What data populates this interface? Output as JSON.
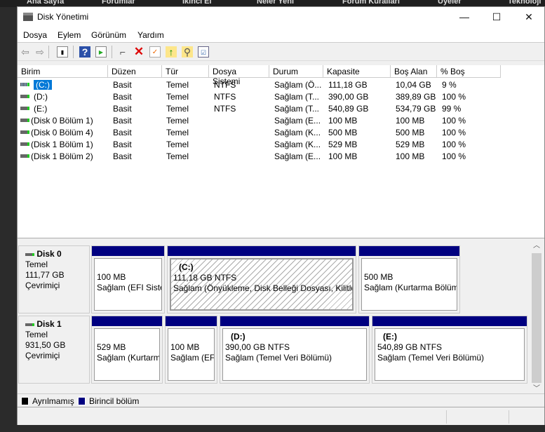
{
  "background_tabs": [
    "Ana Sayfa",
    "Forumlar",
    "İkinci El",
    "Neler Yeni",
    "Forum Kuralları",
    "Üyeler",
    "Teknoloji"
  ],
  "window": {
    "title": "Disk Yönetimi",
    "minimize": "—",
    "maximize": "☐",
    "close": "✕"
  },
  "menu": [
    "Dosya",
    "Eylem",
    "Görünüm",
    "Yardım"
  ],
  "toolbar": [
    "back-icon",
    "forward-icon",
    "console-tree-icon",
    "help-icon",
    "action-pane-icon",
    "connect-disk-icon",
    "delete-icon",
    "properties-icon",
    "folder-up-icon",
    "folder-search-icon",
    "checklist-icon"
  ],
  "columns": [
    "Birim",
    "Düzen",
    "Tür",
    "Dosya Sistemi",
    "Durum",
    "Kapasite",
    "Boş Alan",
    "% Boş"
  ],
  "volumes": [
    [
      "(C:)",
      "Basit",
      "Temel",
      "NTFS",
      "Sağlam (Ö...",
      "111,18 GB",
      "10,04 GB",
      "9 %"
    ],
    [
      "(D:)",
      "Basit",
      "Temel",
      "NTFS",
      "Sağlam (T...",
      "390,00 GB",
      "389,89 GB",
      "100 %"
    ],
    [
      "(E:)",
      "Basit",
      "Temel",
      "NTFS",
      "Sağlam (T...",
      "540,89 GB",
      "534,79 GB",
      "99 %"
    ],
    [
      "(Disk 0 Bölüm 1)",
      "Basit",
      "Temel",
      "",
      "Sağlam (E...",
      "100 MB",
      "100 MB",
      "100 %"
    ],
    [
      "(Disk 0 Bölüm 4)",
      "Basit",
      "Temel",
      "",
      "Sağlam (K...",
      "500 MB",
      "500 MB",
      "100 %"
    ],
    [
      "(Disk 1 Bölüm 1)",
      "Basit",
      "Temel",
      "",
      "Sağlam (K...",
      "529 MB",
      "529 MB",
      "100 %"
    ],
    [
      "(Disk 1 Bölüm 2)",
      "Basit",
      "Temel",
      "",
      "Sağlam (E...",
      "100 MB",
      "100 MB",
      "100 %"
    ]
  ],
  "disks": [
    {
      "name": "Disk 0",
      "type": "Temel",
      "size": "111,77 GB",
      "status": "Çevrimiçi",
      "partitions": [
        {
          "label": "",
          "size": "100 MB",
          "status": "Sağlam (EFI Sistem Bölümü)"
        },
        {
          "label": "(C:)",
          "size": "111,18 GB NTFS",
          "status": "Sağlam (Önyükleme, Disk Belleği Dosyası, Kilitlenme Dökümü, Temel Veri Bölümü)"
        },
        {
          "label": "",
          "size": "500 MB",
          "status": "Sağlam (Kurtarma Bölümü)"
        }
      ]
    },
    {
      "name": "Disk 1",
      "type": "Temel",
      "size": "931,50 GB",
      "status": "Çevrimiçi",
      "partitions": [
        {
          "label": "",
          "size": "529 MB",
          "status": "Sağlam (Kurtarma Bölümü)"
        },
        {
          "label": "",
          "size": "100 MB",
          "status": "Sağlam (EFI Sistem Bölümü)"
        },
        {
          "label": "(D:)",
          "size": "390,00 GB NTFS",
          "status": "Sağlam (Temel Veri Bölümü)"
        },
        {
          "label": "(E:)",
          "size": "540,89 GB NTFS",
          "status": "Sağlam (Temel Veri Bölümü)"
        }
      ]
    }
  ],
  "legend": [
    {
      "label": "Ayrılmamış",
      "color": "#000000"
    },
    {
      "label": "Birincil bölüm",
      "color": "#000080"
    }
  ]
}
